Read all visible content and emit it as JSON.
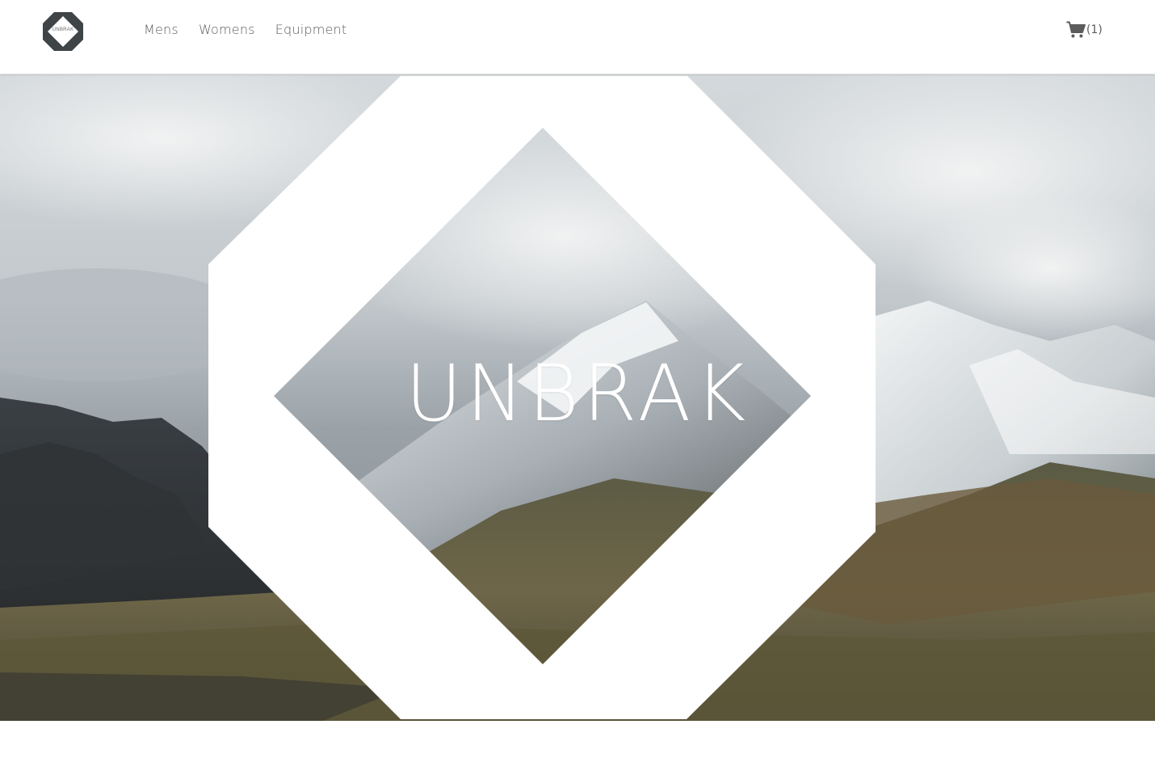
{
  "brand": {
    "logo_text": "UNBRAK",
    "hero_title": "UNBRAK"
  },
  "nav": {
    "items": [
      {
        "label": "Mens"
      },
      {
        "label": "Womens"
      },
      {
        "label": "Equipment"
      }
    ]
  },
  "cart": {
    "icon": "cart-icon",
    "count_label": "(1)"
  },
  "colors": {
    "logo_dark": "#3f4446",
    "nav_text": "#5c5c5c",
    "header_bg": "#ffffff",
    "hero_frame": "#ffffff"
  }
}
